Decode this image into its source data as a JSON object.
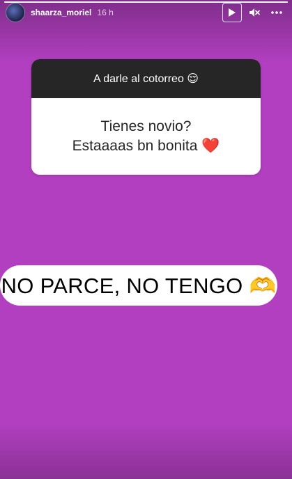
{
  "header": {
    "username": "shaarza_moriel",
    "timestamp": "16 h",
    "progress": 1.0,
    "controls": {
      "play_icon": "play-icon",
      "mute_icon": "mute-icon",
      "more_icon": "more-options-icon"
    }
  },
  "question_sticker": {
    "prompt": "A darle al cotorreo 😌",
    "question_line1": "Tienes novio?",
    "question_line2": "Estaaaas bn bonita ❤️"
  },
  "answer": {
    "text": "NO PARCE, NO TENGO 🫶"
  },
  "colors": {
    "background": "#b13fc0",
    "sticker_header": "#262626",
    "sticker_body": "#ffffff"
  }
}
